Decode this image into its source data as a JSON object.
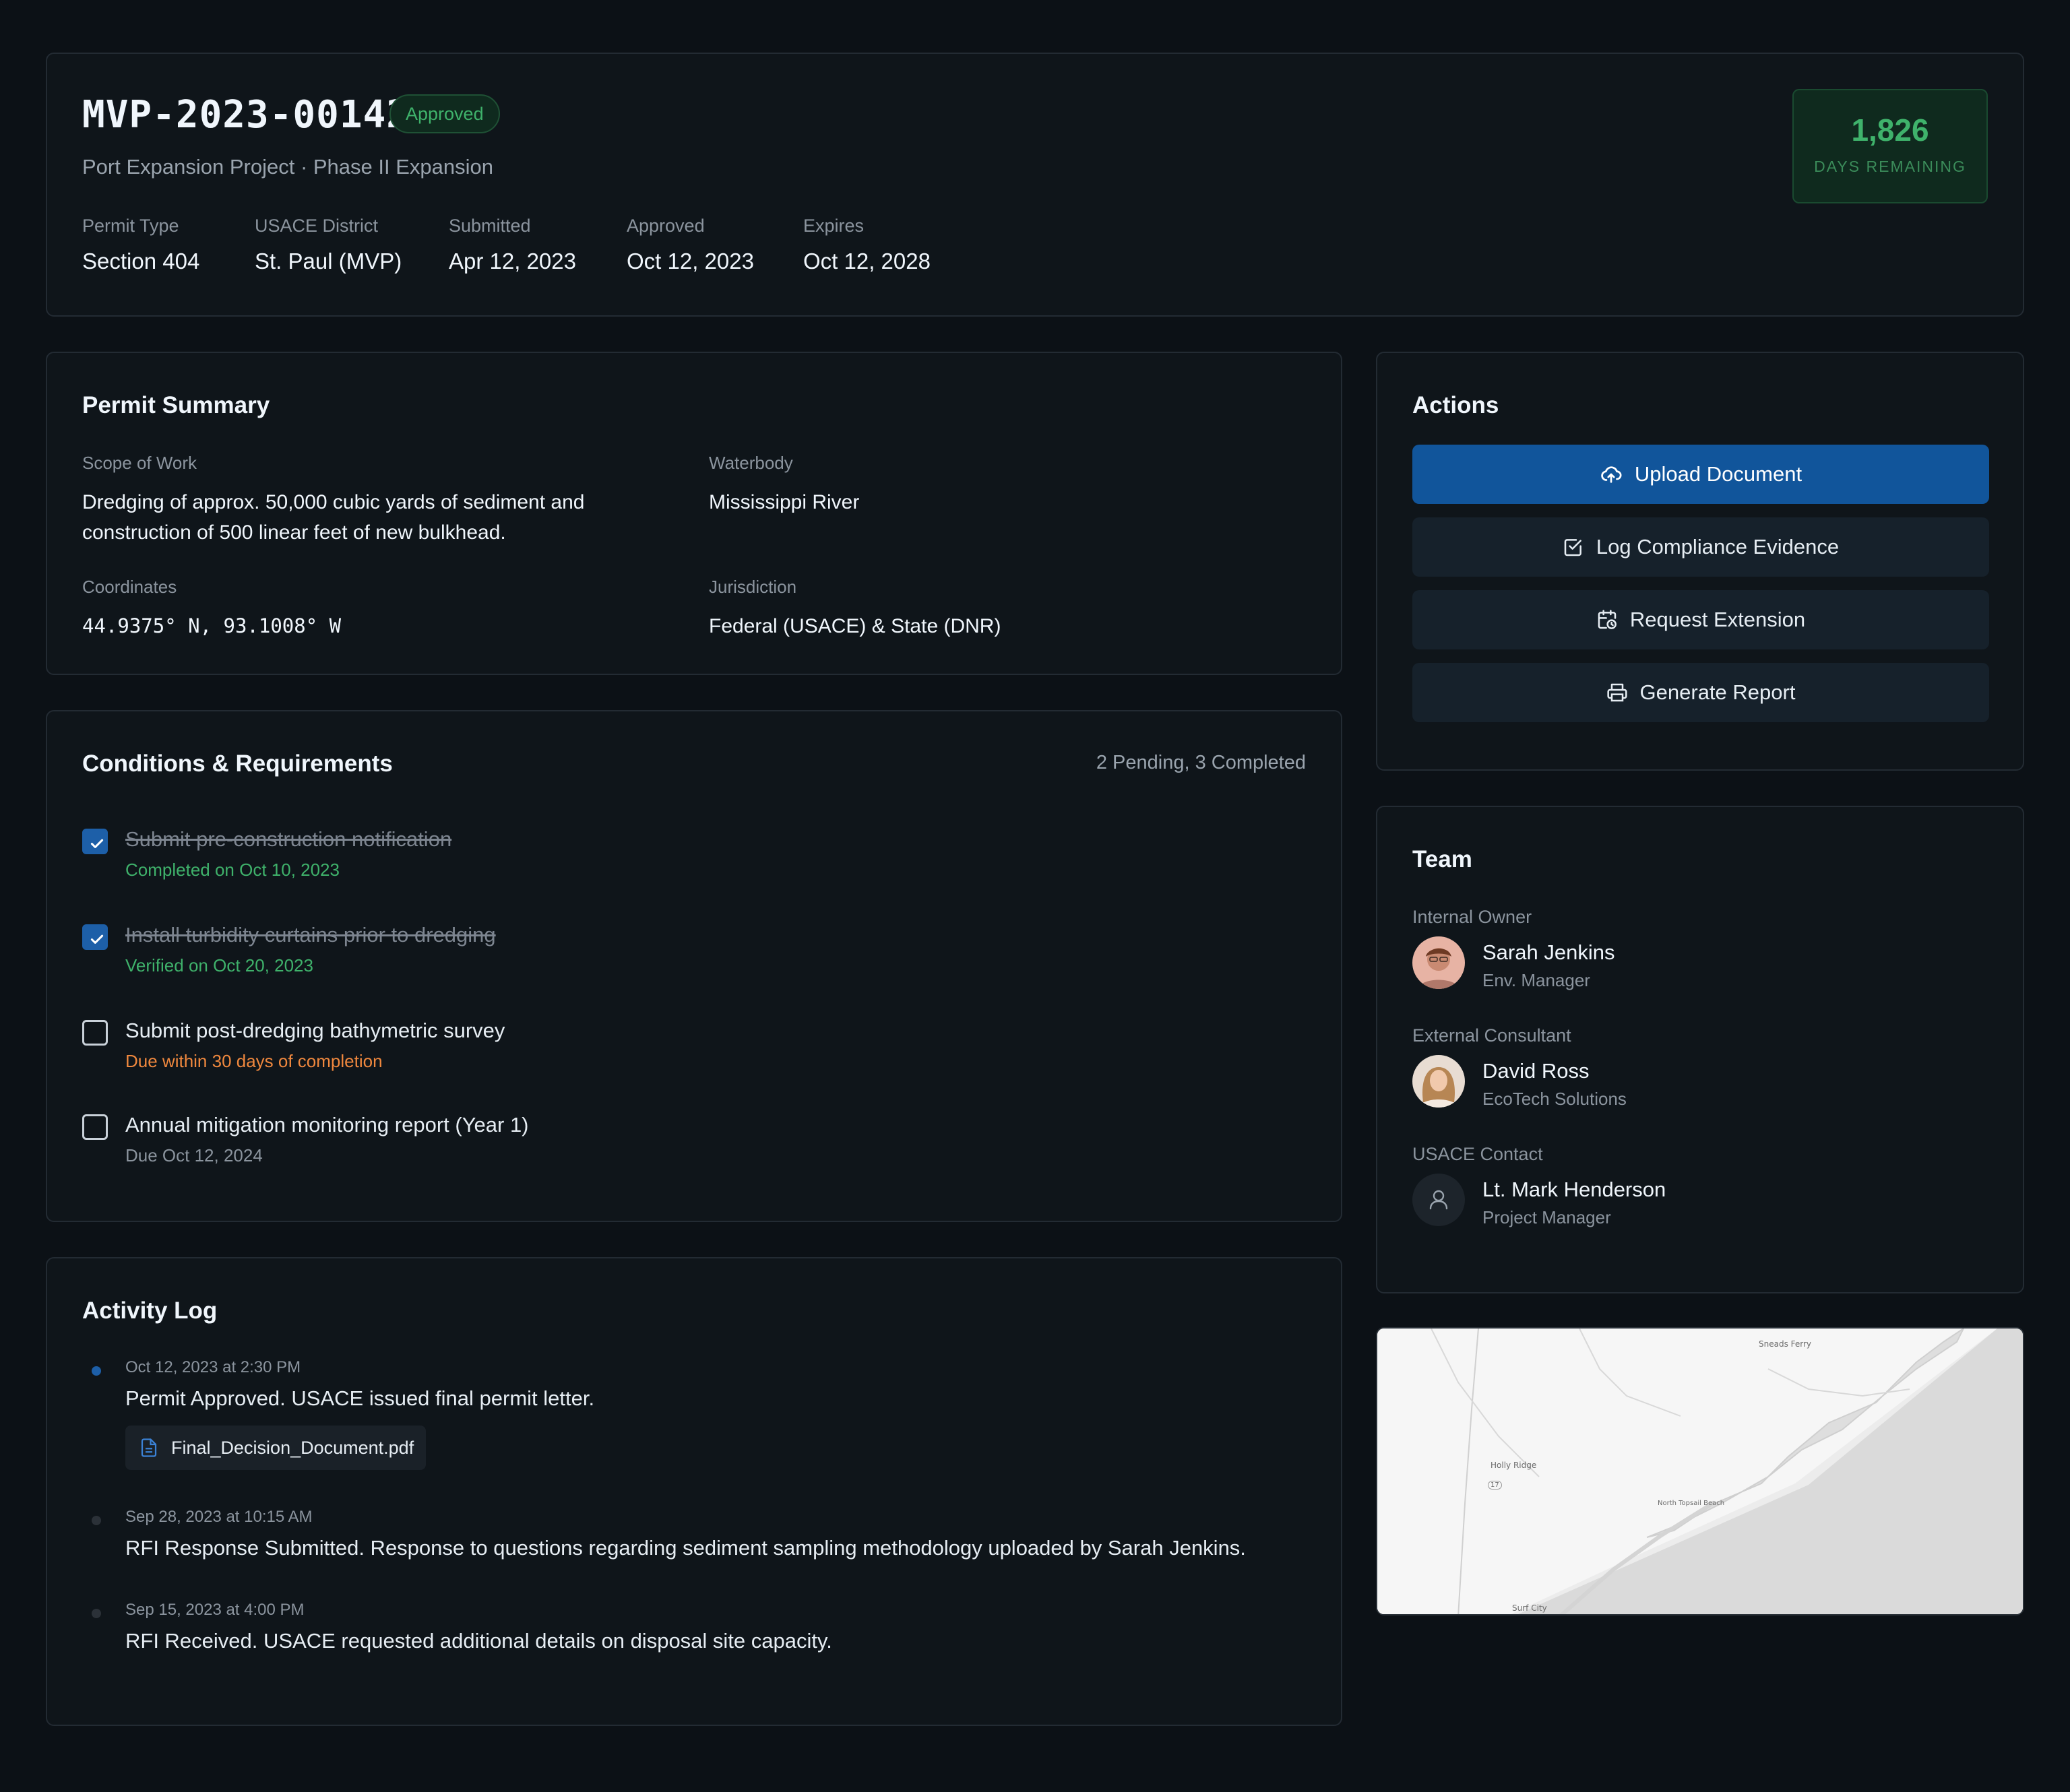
{
  "header": {
    "permit_id": "MVP-2023-00142",
    "status": "Approved",
    "subtitle": "Port Expansion Project · Phase II Expansion",
    "meta": [
      {
        "label": "Permit Type",
        "value": "Section 404"
      },
      {
        "label": "USACE District",
        "value": "St. Paul (MVP)"
      },
      {
        "label": "Submitted",
        "value": "Apr 12, 2023"
      },
      {
        "label": "Approved",
        "value": "Oct 12, 2023"
      },
      {
        "label": "Expires",
        "value": "Oct 12, 2028"
      }
    ],
    "days_remaining": "1,826",
    "days_remaining_label": "DAYS REMAINING"
  },
  "summary": {
    "title": "Permit Summary",
    "scope_label": "Scope of Work",
    "scope_value": "Dredging of approx. 50,000 cubic yards of sediment and construction of 500 linear feet of new bulkhead.",
    "waterbody_label": "Waterbody",
    "waterbody_value": "Mississippi River",
    "coordinates_label": "Coordinates",
    "coordinates_value": "44.9375° N, 93.1008° W",
    "jurisdiction_label": "Jurisdiction",
    "jurisdiction_value": "Federal (USACE) & State (DNR)"
  },
  "conditions": {
    "title": "Conditions & Requirements",
    "count": "2 Pending, 3 Completed",
    "items": [
      {
        "text": "Submit pre-construction notification",
        "sub": "Completed on Oct 10, 2023",
        "checked": true
      },
      {
        "text": "Install turbidity curtains prior to dredging",
        "sub": "Verified on Oct 20, 2023",
        "checked": true
      },
      {
        "text": "Submit post-dredging bathymetric survey",
        "sub": "Due within 30 days of completion",
        "checked": false
      },
      {
        "text": "Annual mitigation monitoring report (Year 1)",
        "sub": "Due Oct 12, 2024",
        "checked": false
      }
    ]
  },
  "activity": {
    "title": "Activity Log",
    "items": [
      {
        "time": "Oct 12, 2023 at 2:30 PM",
        "message": "Permit Approved. USACE issued final permit letter.",
        "file": "Final_Decision_Document.pdf"
      },
      {
        "time": "Sep 28, 2023 at 10:15 AM",
        "message": "RFI Response Submitted. Response to questions regarding sediment sampling methodology uploaded by Sarah Jenkins."
      },
      {
        "time": "Sep 15, 2023 at 4:00 PM",
        "message": "RFI Received. USACE requested additional details on disposal site capacity."
      }
    ]
  },
  "actions": {
    "title": "Actions",
    "upload": "Upload Document",
    "log": "Log Compliance Evidence",
    "extension": "Request Extension",
    "report": "Generate Report"
  },
  "team": {
    "title": "Team",
    "members": [
      {
        "role": "Internal Owner",
        "name": "Sarah Jenkins",
        "title": "Env. Manager"
      },
      {
        "role": "External Consultant",
        "name": "David Ross",
        "title": "EcoTech Solutions"
      },
      {
        "role": "USACE Contact",
        "name": "Lt. Mark Henderson",
        "title": "Project Manager"
      }
    ]
  },
  "map": {
    "labels": [
      "Sneads Ferry",
      "Holly Ridge",
      "North Topsail Beach",
      "Surf City",
      "17"
    ]
  },
  "colors": {
    "background": "#0c1116",
    "card": "#0f151a",
    "primary": "#11559b",
    "success": "#3fb26b",
    "warning": "#f0883e"
  },
  "icons": [
    "cloud-upload-icon",
    "checkbox-icon",
    "calendar-clock-icon",
    "printer-icon",
    "file-icon",
    "user-icon",
    "check-icon"
  ]
}
